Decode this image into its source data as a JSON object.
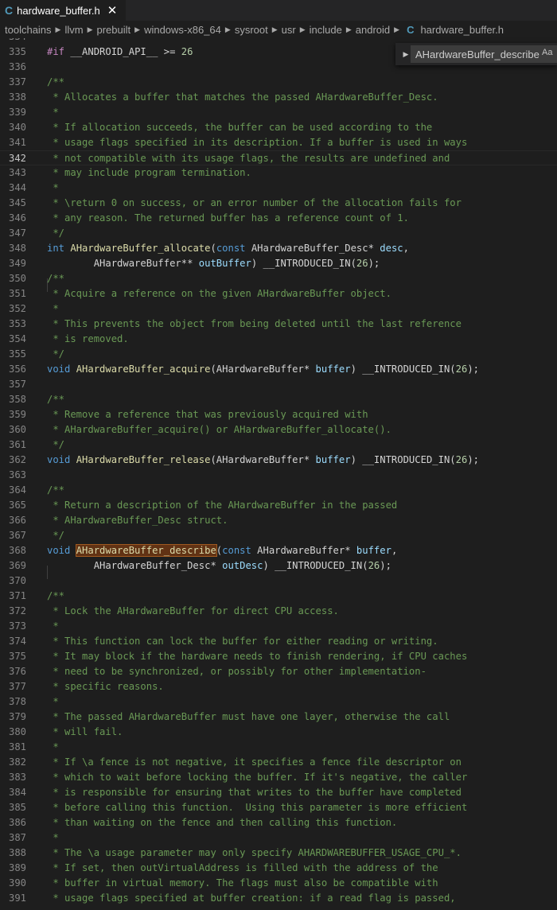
{
  "tab": {
    "icon": "c-file-icon",
    "icon_glyph": "C",
    "title": "hardware_buffer.h",
    "close_glyph": "✕"
  },
  "breadcrumb": {
    "items": [
      "toolchains",
      "llvm",
      "prebuilt",
      "windows-x86_64",
      "sysroot",
      "usr",
      "include",
      "android"
    ],
    "file_icon_glyph": "C",
    "file": "hardware_buffer.h",
    "separator_glyph": "▶"
  },
  "find": {
    "value": "AHardwareBuffer_describe",
    "match_case_label": "Aa",
    "toggle_glyph": "▶"
  },
  "editor": {
    "current_line": "342",
    "lines": [
      {
        "n": "334",
        "t": []
      },
      {
        "n": "335",
        "t": [
          [
            "pp",
            "#if "
          ],
          [
            "pl",
            "__ANDROID_API__ >= "
          ],
          [
            "num",
            "26"
          ]
        ]
      },
      {
        "n": "336",
        "t": []
      },
      {
        "n": "337",
        "t": [
          [
            "cm",
            "/**"
          ]
        ]
      },
      {
        "n": "338",
        "t": [
          [
            "cm",
            " * Allocates a buffer that matches the passed AHardwareBuffer_Desc."
          ]
        ]
      },
      {
        "n": "339",
        "t": [
          [
            "cm",
            " *"
          ]
        ]
      },
      {
        "n": "340",
        "t": [
          [
            "cm",
            " * If allocation succeeds, the buffer can be used according to the"
          ]
        ]
      },
      {
        "n": "341",
        "t": [
          [
            "cm",
            " * usage flags specified in its description. If a buffer is used in ways"
          ]
        ]
      },
      {
        "n": "342",
        "t": [
          [
            "cm",
            " * not compatible with its usage flags, the results are undefined and"
          ]
        ]
      },
      {
        "n": "343",
        "t": [
          [
            "cm",
            " * may include program termination."
          ]
        ]
      },
      {
        "n": "344",
        "t": [
          [
            "cm",
            " *"
          ]
        ]
      },
      {
        "n": "345",
        "t": [
          [
            "cm",
            " * \\return 0 on success, or an error number of the allocation fails for"
          ]
        ]
      },
      {
        "n": "346",
        "t": [
          [
            "cm",
            " * any reason. The returned buffer has a reference count of 1."
          ]
        ]
      },
      {
        "n": "347",
        "t": [
          [
            "cm",
            " */"
          ]
        ]
      },
      {
        "n": "348",
        "t": [
          [
            "kw",
            "int "
          ],
          [
            "fn",
            "AHardwareBuffer_allocate"
          ],
          [
            "pl",
            "("
          ],
          [
            "kw",
            "const "
          ],
          [
            "pl",
            "AHardwareBuffer_Desc* "
          ],
          [
            "id",
            "desc"
          ],
          [
            "pl",
            ","
          ]
        ]
      },
      {
        "n": "349",
        "t": [
          [
            "pl",
            "        AHardwareBuffer** "
          ],
          [
            "id",
            "outBuffer"
          ],
          [
            "pl",
            ") __INTRODUCED_IN("
          ],
          [
            "num",
            "26"
          ],
          [
            "pl",
            ");"
          ]
        ]
      },
      {
        "n": "350",
        "t": [
          [
            "cm",
            "/**"
          ]
        ]
      },
      {
        "n": "351",
        "t": [
          [
            "cm",
            " * Acquire a reference on the given AHardwareBuffer object."
          ]
        ]
      },
      {
        "n": "352",
        "t": [
          [
            "cm",
            " *"
          ]
        ]
      },
      {
        "n": "353",
        "t": [
          [
            "cm",
            " * This prevents the object from being deleted until the last reference"
          ]
        ]
      },
      {
        "n": "354",
        "t": [
          [
            "cm",
            " * is removed."
          ]
        ]
      },
      {
        "n": "355",
        "t": [
          [
            "cm",
            " */"
          ]
        ]
      },
      {
        "n": "356",
        "t": [
          [
            "kw",
            "void "
          ],
          [
            "fn",
            "AHardwareBuffer_acquire"
          ],
          [
            "pl",
            "(AHardwareBuffer* "
          ],
          [
            "id",
            "buffer"
          ],
          [
            "pl",
            ") __INTRODUCED_IN("
          ],
          [
            "num",
            "26"
          ],
          [
            "pl",
            ");"
          ]
        ]
      },
      {
        "n": "357",
        "t": []
      },
      {
        "n": "358",
        "t": [
          [
            "cm",
            "/**"
          ]
        ]
      },
      {
        "n": "359",
        "t": [
          [
            "cm",
            " * Remove a reference that was previously acquired with"
          ]
        ]
      },
      {
        "n": "360",
        "t": [
          [
            "cm",
            " * AHardwareBuffer_acquire() or AHardwareBuffer_allocate()."
          ]
        ]
      },
      {
        "n": "361",
        "t": [
          [
            "cm",
            " */"
          ]
        ]
      },
      {
        "n": "362",
        "t": [
          [
            "kw",
            "void "
          ],
          [
            "fn",
            "AHardwareBuffer_release"
          ],
          [
            "pl",
            "(AHardwareBuffer* "
          ],
          [
            "id",
            "buffer"
          ],
          [
            "pl",
            ") __INTRODUCED_IN("
          ],
          [
            "num",
            "26"
          ],
          [
            "pl",
            ");"
          ]
        ]
      },
      {
        "n": "363",
        "t": []
      },
      {
        "n": "364",
        "t": [
          [
            "cm",
            "/**"
          ]
        ]
      },
      {
        "n": "365",
        "t": [
          [
            "cm",
            " * Return a description of the AHardwareBuffer in the passed"
          ]
        ]
      },
      {
        "n": "366",
        "t": [
          [
            "cm",
            " * AHardwareBuffer_Desc struct."
          ]
        ]
      },
      {
        "n": "367",
        "t": [
          [
            "cm",
            " */"
          ]
        ]
      },
      {
        "n": "368",
        "t": [
          [
            "kw",
            "void "
          ],
          [
            "fn hl",
            "AHardwareBuffer_describe"
          ],
          [
            "pl",
            "("
          ],
          [
            "kw",
            "const "
          ],
          [
            "pl",
            "AHardwareBuffer* "
          ],
          [
            "id",
            "buffer"
          ],
          [
            "pl",
            ","
          ]
        ]
      },
      {
        "n": "369",
        "t": [
          [
            "pl",
            "        AHardwareBuffer_Desc* "
          ],
          [
            "id",
            "outDesc"
          ],
          [
            "pl",
            ") __INTRODUCED_IN("
          ],
          [
            "num",
            "26"
          ],
          [
            "pl",
            ");"
          ]
        ]
      },
      {
        "n": "370",
        "t": []
      },
      {
        "n": "371",
        "t": [
          [
            "cm",
            "/**"
          ]
        ]
      },
      {
        "n": "372",
        "t": [
          [
            "cm",
            " * Lock the AHardwareBuffer for direct CPU access."
          ]
        ]
      },
      {
        "n": "373",
        "t": [
          [
            "cm",
            " *"
          ]
        ]
      },
      {
        "n": "374",
        "t": [
          [
            "cm",
            " * This function can lock the buffer for either reading or writing."
          ]
        ]
      },
      {
        "n": "375",
        "t": [
          [
            "cm",
            " * It may block if the hardware needs to finish rendering, if CPU caches"
          ]
        ]
      },
      {
        "n": "376",
        "t": [
          [
            "cm",
            " * need to be synchronized, or possibly for other implementation-"
          ]
        ]
      },
      {
        "n": "377",
        "t": [
          [
            "cm",
            " * specific reasons."
          ]
        ]
      },
      {
        "n": "378",
        "t": [
          [
            "cm",
            " *"
          ]
        ]
      },
      {
        "n": "379",
        "t": [
          [
            "cm",
            " * The passed AHardwareBuffer must have one layer, otherwise the call"
          ]
        ]
      },
      {
        "n": "380",
        "t": [
          [
            "cm",
            " * will fail."
          ]
        ]
      },
      {
        "n": "381",
        "t": [
          [
            "cm",
            " *"
          ]
        ]
      },
      {
        "n": "382",
        "t": [
          [
            "cm",
            " * If \\a fence is not negative, it specifies a fence file descriptor on"
          ]
        ]
      },
      {
        "n": "383",
        "t": [
          [
            "cm",
            " * which to wait before locking the buffer. If it's negative, the caller"
          ]
        ]
      },
      {
        "n": "384",
        "t": [
          [
            "cm",
            " * is responsible for ensuring that writes to the buffer have completed"
          ]
        ]
      },
      {
        "n": "385",
        "t": [
          [
            "cm",
            " * before calling this function.  Using this parameter is more efficient"
          ]
        ]
      },
      {
        "n": "386",
        "t": [
          [
            "cm",
            " * than waiting on the fence and then calling this function."
          ]
        ]
      },
      {
        "n": "387",
        "t": [
          [
            "cm",
            " *"
          ]
        ]
      },
      {
        "n": "388",
        "t": [
          [
            "cm",
            " * The \\a usage parameter may only specify AHARDWAREBUFFER_USAGE_CPU_*."
          ]
        ]
      },
      {
        "n": "389",
        "t": [
          [
            "cm",
            " * If set, then outVirtualAddress is filled with the address of the"
          ]
        ]
      },
      {
        "n": "390",
        "t": [
          [
            "cm",
            " * buffer in virtual memory. The flags must also be compatible with"
          ]
        ]
      },
      {
        "n": "391",
        "t": [
          [
            "cm",
            " * usage flags specified at buffer creation: if a read flag is passed,"
          ]
        ]
      }
    ]
  }
}
